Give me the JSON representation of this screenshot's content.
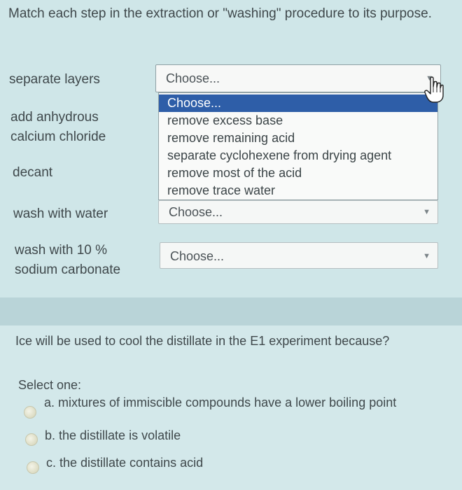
{
  "question1": {
    "prompt": "Match each step in the extraction or \"washing\" procedure to its purpose.",
    "steps": [
      {
        "line1": "separate layers",
        "line2": ""
      },
      {
        "line1": "add anhydrous",
        "line2": "calcium chloride"
      },
      {
        "line1": "decant",
        "line2": ""
      },
      {
        "line1": "wash with water",
        "line2": ""
      },
      {
        "line1": "wash with 10 %",
        "line2": "sodium carbonate"
      }
    ],
    "active_select_value": "Choose...",
    "dropdown_options": [
      "Choose...",
      "remove excess base",
      "remove remaining acid",
      "separate cyclohexene from drying agent",
      "remove most of the acid",
      "remove trace water"
    ],
    "select_wash_water_value": "Choose...",
    "select_sodium_carbonate_value": "Choose..."
  },
  "question2": {
    "text": "Ice will be used to cool the distillate in the E1 experiment because?",
    "select_one_label": "Select one:",
    "answers": [
      "a. mixtures of immiscible compounds have a lower boiling point",
      "b. the distillate is volatile",
      "c. the distillate contains acid"
    ]
  },
  "icons": {
    "dropdown_arrow": "chevron-down-icon",
    "cursor": "hand-pointer-icon"
  },
  "colors": {
    "selected_option_bg": "#2e5ea8",
    "page_bg": "#c9e1e4"
  }
}
